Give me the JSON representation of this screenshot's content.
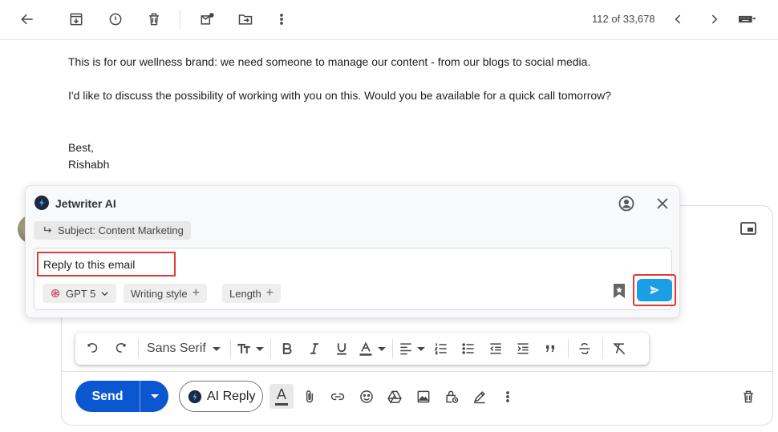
{
  "toolbar": {
    "pager_text": "112 of 33,678"
  },
  "email": {
    "line1": "This is for our wellness brand: we need someone to manage our content - from our blogs to social media.",
    "line2": "I'd like to discuss the possibility of working with you on this. Would you be available for a quick call tomorrow?",
    "signoff": "Best,",
    "sender_name": "Rishabh"
  },
  "jetwriter": {
    "title": "Jetwriter AI",
    "subject": "Subject: Content Marketing",
    "input_value": "Reply to this email",
    "model_chip": "GPT 5",
    "writing_style_chip": "Writing style",
    "length_chip": "Length"
  },
  "format_bar": {
    "font_name": "Sans Serif"
  },
  "compose": {
    "send_label": "Send",
    "ai_reply_label": "AI Reply",
    "text_color_letter": "A"
  },
  "colors": {
    "send_blue": "#0b57d0",
    "jetwriter_send": "#1a9ee5",
    "highlight_red": "#e53935"
  }
}
